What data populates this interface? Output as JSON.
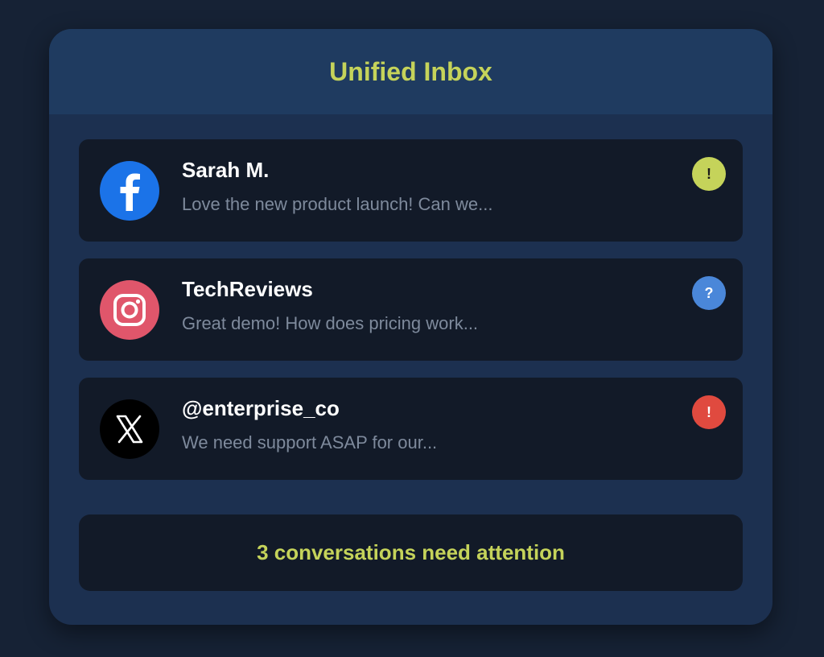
{
  "header": {
    "title": "Unified Inbox"
  },
  "colors": {
    "accent": "#c5d35a",
    "facebook": "#1b73e8",
    "instagram": "#e0566b",
    "x": "#000000",
    "badge_warning": "#c5d35a",
    "badge_question": "#4a87d9",
    "badge_urgent": "#e04a3f"
  },
  "messages": [
    {
      "platform_icon": "facebook-icon",
      "sender": "Sarah M.",
      "preview": "Love the new product launch! Can we...",
      "badge": "!",
      "badge_icon": "exclamation-icon",
      "badge_status": "warning"
    },
    {
      "platform_icon": "instagram-icon",
      "sender": "TechReviews",
      "preview": "Great demo! How does pricing work...",
      "badge": "?",
      "badge_icon": "question-icon",
      "badge_status": "question"
    },
    {
      "platform_icon": "x-icon",
      "sender": "@enterprise_co",
      "preview": "We need support ASAP for our...",
      "badge": "!",
      "badge_icon": "exclamation-icon",
      "badge_status": "urgent"
    }
  ],
  "footer": {
    "summary": "3 conversations need attention"
  }
}
